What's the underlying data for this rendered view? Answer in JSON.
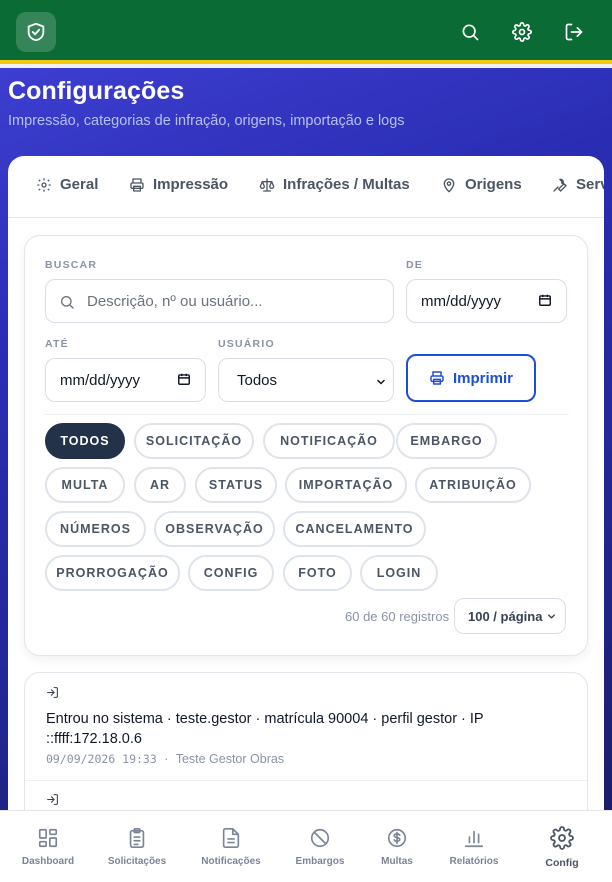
{
  "header": {
    "logo_icon": "shield-check-icon",
    "actions": [
      "search-icon",
      "gear-icon",
      "logout-icon"
    ],
    "colors": {
      "bar": "#0a6b35",
      "accent_stripe": "#f2c80f"
    }
  },
  "page": {
    "title": "Configurações",
    "subtitle": "Impressão, categorias de infração, origens, importação e logs"
  },
  "tabs": [
    {
      "label": "Geral",
      "icon": "gear-icon"
    },
    {
      "label": "Impressão",
      "icon": "printer-icon"
    },
    {
      "label": "Infrações / Multas",
      "icon": "scale-icon"
    },
    {
      "label": "Origens",
      "icon": "map-pin-icon"
    },
    {
      "label": "Serv",
      "icon": "wrench-icon"
    }
  ],
  "filters": {
    "search_label": "BUSCAR",
    "search_placeholder": "Descrição, nº ou usuário...",
    "from_label": "DE",
    "from_value": "mm/dd/yyyy",
    "to_label": "ATÉ",
    "to_value": "mm/dd/yyyy",
    "user_label": "USUÁRIO",
    "user_value": "Todos",
    "print_label": "Imprimir",
    "chips": [
      "TODOS",
      "SOLICITAÇÃO",
      "NOTIFICAÇÃO",
      "EMBARGO",
      "MULTA",
      "AR",
      "STATUS",
      "IMPORTAÇÃO",
      "ATRIBUIÇÃO",
      "NÚMEROS",
      "OBSERVAÇÃO",
      "CANCELAMENTO",
      "PRORROGAÇÃO",
      "CONFIG",
      "FOTO",
      "LOGIN"
    ],
    "active_chip": "TODOS",
    "count_text": "60 de 60 registros",
    "page_size": "100 / página"
  },
  "logs": [
    {
      "icon": "login-icon",
      "text": "Entrou no sistema · teste.gestor · matrícula 90004 · perfil gestor · IP ::ffff:172.18.0.6",
      "timestamp": "09/09/2026 19:33",
      "separator": "·",
      "user": "Teste Gestor Obras"
    },
    {
      "icon": "login-icon"
    }
  ],
  "bottom_nav": [
    {
      "label": "Dashboard",
      "icon": "dashboard-icon"
    },
    {
      "label": "Solicitações",
      "icon": "clipboard-icon"
    },
    {
      "label": "Notificações",
      "icon": "document-icon"
    },
    {
      "label": "Embargos",
      "icon": "ban-icon"
    },
    {
      "label": "Multas",
      "icon": "dollar-icon"
    },
    {
      "label": "Relatórios",
      "icon": "bar-chart-icon"
    },
    {
      "label": "Config",
      "icon": "gear-icon",
      "active": true
    }
  ]
}
